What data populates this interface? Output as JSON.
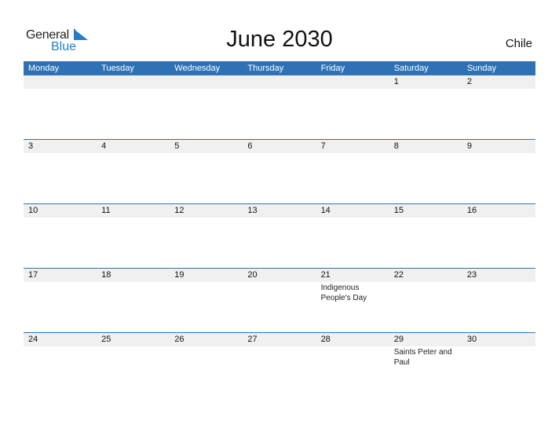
{
  "logo": {
    "general": "General",
    "blue": "Blue"
  },
  "title": "June 2030",
  "country": "Chile",
  "colors": {
    "accent": "#2e72b4",
    "strip": "#f0f0f0"
  },
  "weekdays": [
    "Monday",
    "Tuesday",
    "Wednesday",
    "Thursday",
    "Friday",
    "Saturday",
    "Sunday"
  ],
  "weeks": [
    {
      "days": [
        "",
        "",
        "",
        "",
        "",
        "1",
        "2"
      ],
      "events": [
        "",
        "",
        "",
        "",
        "",
        "",
        ""
      ]
    },
    {
      "days": [
        "3",
        "4",
        "5",
        "6",
        "7",
        "8",
        "9"
      ],
      "events": [
        "",
        "",
        "",
        "",
        "",
        "",
        ""
      ]
    },
    {
      "days": [
        "10",
        "11",
        "12",
        "13",
        "14",
        "15",
        "16"
      ],
      "events": [
        "",
        "",
        "",
        "",
        "",
        "",
        ""
      ]
    },
    {
      "days": [
        "17",
        "18",
        "19",
        "20",
        "21",
        "22",
        "23"
      ],
      "events": [
        "",
        "",
        "",
        "",
        "Indigenous People's Day",
        "",
        ""
      ]
    },
    {
      "days": [
        "24",
        "25",
        "26",
        "27",
        "28",
        "29",
        "30"
      ],
      "events": [
        "",
        "",
        "",
        "",
        "",
        "Saints Peter and Paul",
        ""
      ]
    }
  ]
}
